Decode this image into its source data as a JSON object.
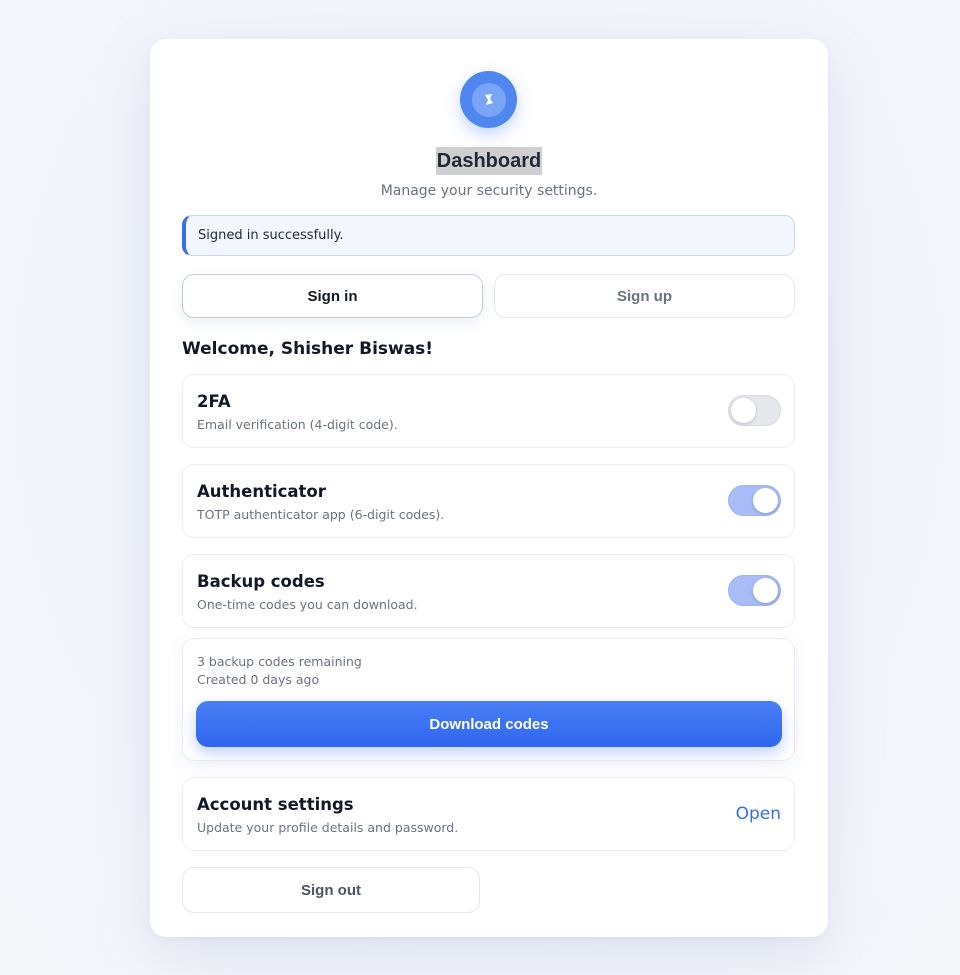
{
  "header": {
    "logo_icon": "pin-icon",
    "title": "Dashboard",
    "subtitle": "Manage your security settings."
  },
  "alert": {
    "message": "Signed in successfully.",
    "accent_color": "#3b6fe6"
  },
  "tabs": [
    {
      "label": "Sign in",
      "active": true
    },
    {
      "label": "Sign up",
      "active": false
    }
  ],
  "welcome": "Welcome, Shisher Biswas!",
  "security": {
    "two_fa": {
      "title": "2FA",
      "description": "Email verification (4-digit code).",
      "enabled": false
    },
    "authenticator": {
      "title": "Authenticator",
      "description": "TOTP authenticator app (6-digit codes).",
      "enabled": true
    },
    "backup_codes": {
      "title": "Backup codes",
      "description": "One-time codes you can download.",
      "enabled": true,
      "remaining": "3 backup codes remaining",
      "created": "Created 0 days ago",
      "download_label": "Download codes"
    }
  },
  "account": {
    "title": "Account settings",
    "description": "Update your profile details and password.",
    "open_label": "Open"
  },
  "sign_out_label": "Sign out",
  "colors": {
    "primary": "#2f66ef",
    "toggle_on": "#a9bcf7",
    "toggle_off": "#e5e7eb",
    "link": "#3b6fe6"
  }
}
